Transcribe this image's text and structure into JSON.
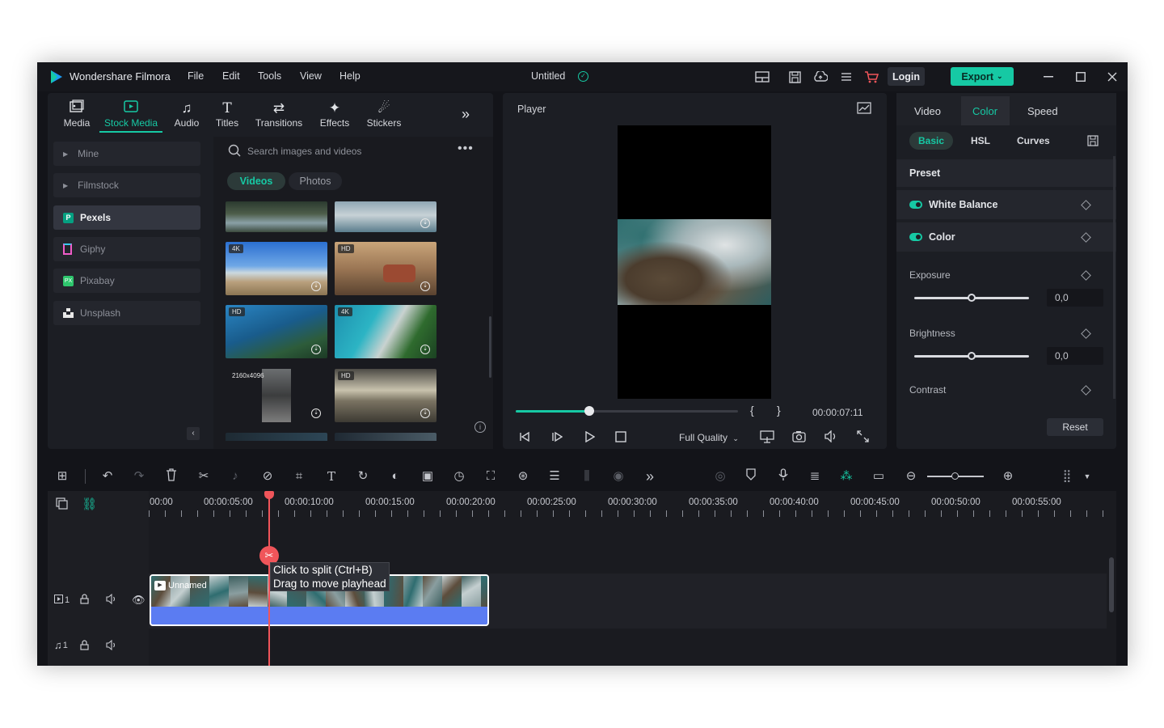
{
  "app": {
    "name": "Wondershare Filmora",
    "project_title": "Untitled",
    "menu": [
      "File",
      "Edit",
      "Tools",
      "View",
      "Help"
    ],
    "login_label": "Login",
    "export_label": "Export"
  },
  "media_tabs": [
    {
      "label": "Media",
      "icon": "media-icon"
    },
    {
      "label": "Stock Media",
      "icon": "stock-media-icon",
      "active": true
    },
    {
      "label": "Audio",
      "icon": "audio-icon"
    },
    {
      "label": "Titles",
      "icon": "titles-icon"
    },
    {
      "label": "Transitions",
      "icon": "transitions-icon"
    },
    {
      "label": "Effects",
      "icon": "effects-icon"
    },
    {
      "label": "Stickers",
      "icon": "stickers-icon"
    }
  ],
  "sidebar": {
    "items": [
      {
        "label": "Mine"
      },
      {
        "label": "Filmstock"
      },
      {
        "label": "Pexels",
        "active": true
      },
      {
        "label": "Giphy"
      },
      {
        "label": "Pixabay"
      },
      {
        "label": "Unsplash"
      }
    ]
  },
  "browser": {
    "search_placeholder": "Search images and videos",
    "filter_tabs": [
      "Videos",
      "Photos"
    ],
    "badges": {
      "4k": "4K",
      "hd": "HD",
      "res": "2160x4096"
    }
  },
  "player": {
    "title": "Player",
    "timecode": "00:00:07:11",
    "quality": "Full Quality",
    "progress": 0.33
  },
  "props": {
    "tabs": [
      "Video",
      "Color",
      "Speed"
    ],
    "subtabs": [
      "Basic",
      "HSL",
      "Curves"
    ],
    "preset_label": "Preset",
    "white_balance_label": "White Balance",
    "color_label": "Color",
    "exposure": {
      "label": "Exposure",
      "value": "0,0",
      "level": 0.5
    },
    "brightness": {
      "label": "Brightness",
      "value": "0,0",
      "level": 0.5
    },
    "contrast_label": "Contrast",
    "reset_label": "Reset"
  },
  "timeline": {
    "ruler": [
      "00:00",
      "00:00:05:00",
      "00:00:10:00",
      "00:00:15:00",
      "00:00:20:00",
      "00:00:25:00",
      "00:00:30:00",
      "00:00:35:00",
      "00:00:40:00",
      "00:00:45:00",
      "00:00:50:00",
      "00:00:55:00"
    ],
    "tooltip_line1": "Click to split (Ctrl+B)",
    "tooltip_line2": "Drag to move playhead",
    "clip_name": "Unnamed",
    "video_track_num": "1",
    "audio_track_num": "1"
  },
  "colors": {
    "accent": "#16c9a4",
    "clip_bar": "#5b7cf2",
    "playhead": "#f0555a"
  }
}
